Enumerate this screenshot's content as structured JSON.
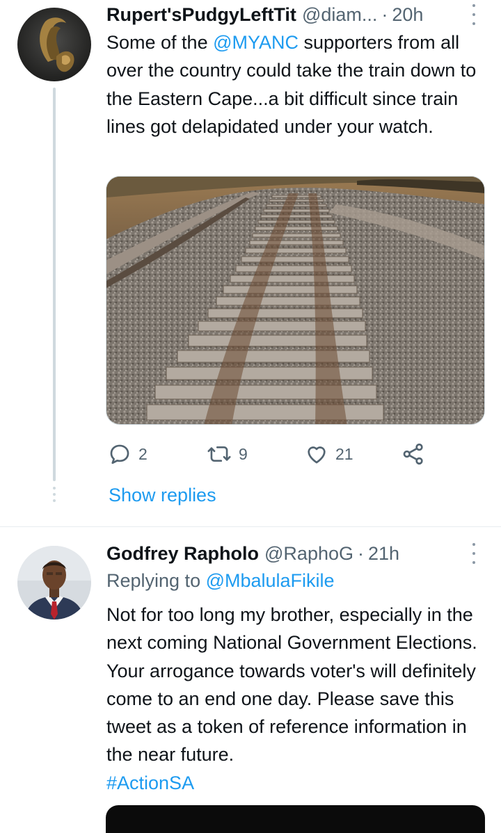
{
  "tweets": [
    {
      "display_name": "Rupert'sPudgyLeftTit",
      "handle": "@diam...",
      "separator": "·",
      "time": "20h",
      "text_parts": {
        "before": "Some of the ",
        "mention": "@MYANC",
        "after": " supporters from all over the country could take the train down to the Eastern Cape...a bit difficult since train lines got delapidated under your watch."
      },
      "media": "railway-tracks-photo",
      "actions": {
        "replies": "2",
        "retweets": "9",
        "likes": "21"
      },
      "show_replies": "Show replies"
    },
    {
      "display_name": "Godfrey Rapholo",
      "handle": "@RaphoG",
      "separator": "·",
      "time": "21h",
      "replying_label": "Replying to ",
      "replying_to": "@MbalulaFikile",
      "text": "Not for too long my brother, especially in the next coming National Government Elections. Your arrogance towards voter's will definitely come to an end one day. Please save this tweet as a token of reference information in the near future.",
      "hashtag": "#ActionSA"
    }
  ],
  "icons": {
    "reply": "reply-icon",
    "retweet": "retweet-icon",
    "like": "heart-icon",
    "share": "share-icon",
    "more": "more-options-icon"
  },
  "colors": {
    "link": "#1d9bf0",
    "secondary_text": "#536471",
    "primary_text": "#0f1419",
    "thread_line": "#cfd9de"
  }
}
